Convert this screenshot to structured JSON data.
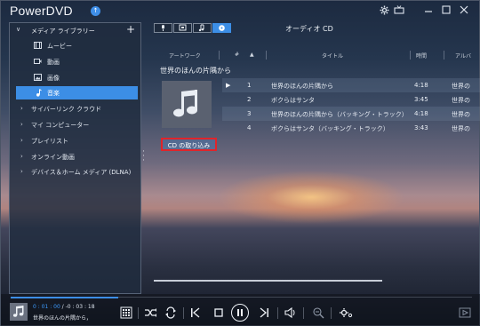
{
  "app": {
    "title": "PowerDVD",
    "badge": "↑"
  },
  "sidebar": {
    "library_label": "メディア ライブラリー",
    "items": [
      {
        "label": "ムービー",
        "icon": "film-icon"
      },
      {
        "label": "動画",
        "icon": "video-icon"
      },
      {
        "label": "画像",
        "icon": "image-icon"
      },
      {
        "label": "音楽",
        "icon": "music-note-icon",
        "active": true
      }
    ],
    "groups": [
      "サイバーリンク クラウド",
      "マイ コンピューター",
      "プレイリスト",
      "オンライン動画",
      "デバイス＆ホーム メディア (DLNA)"
    ]
  },
  "content": {
    "tabs": [
      "microphone-icon",
      "screen-icon",
      "music-note-icon",
      "disc-icon"
    ],
    "active_tab": 3,
    "disc_title": "オーディオ CD",
    "columns": {
      "artwork": "アートワーク",
      "number": "#",
      "title": "タイトル",
      "time": "時間",
      "artist": "アルバ"
    },
    "album_title": "世界のほんの片隅から",
    "import_button": "CD の取り込み",
    "tracks": [
      {
        "no": "1",
        "title": "世界のほんの片隅から",
        "time": "4:18",
        "artist": "世界の",
        "playing": true
      },
      {
        "no": "2",
        "title": "ボクらはサンタ",
        "time": "3:45",
        "artist": "世界の"
      },
      {
        "no": "3",
        "title": "世界のほんの片隅から（バッキング・トラック）",
        "time": "4:18",
        "artist": "世界の"
      },
      {
        "no": "4",
        "title": "ボクらはサンタ（バッキング・トラック）",
        "time": "3:43",
        "artist": "世界の"
      }
    ]
  },
  "player": {
    "elapsed": "0 : 01 : 00",
    "separator": " / ",
    "remaining": "-0 : 03 : 18",
    "now_playing": "世界のほんの片隅から，",
    "progress_fraction": 0.23
  },
  "colors": {
    "accent": "#3c8ee6",
    "highlight_border": "#e0242a"
  }
}
